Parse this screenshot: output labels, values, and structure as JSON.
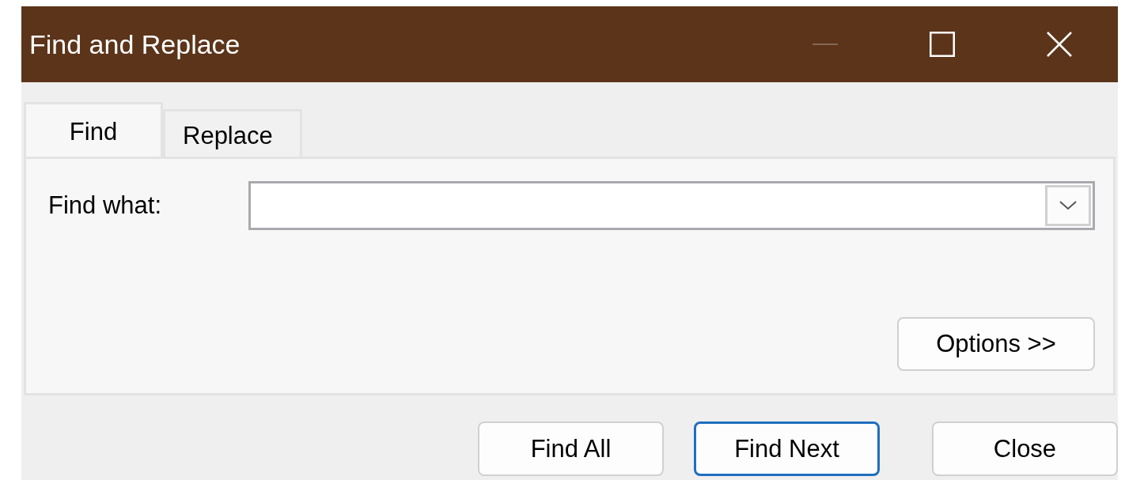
{
  "window": {
    "title": "Find and Replace",
    "controls": [
      {
        "kind": "minimize",
        "disabled": true
      },
      {
        "kind": "maximize",
        "disabled": false
      },
      {
        "kind": "close",
        "disabled": false
      }
    ]
  },
  "tabs": [
    {
      "label": "Find",
      "selected": true
    },
    {
      "label": "Replace",
      "selected": false
    }
  ],
  "find_what": {
    "label": "Find what:"
  },
  "options_button": "Options >>",
  "buttons": [
    {
      "label": "Find All",
      "default": false
    },
    {
      "label": "Find Next",
      "default": true
    },
    {
      "label": "Close",
      "default": false
    }
  ]
}
